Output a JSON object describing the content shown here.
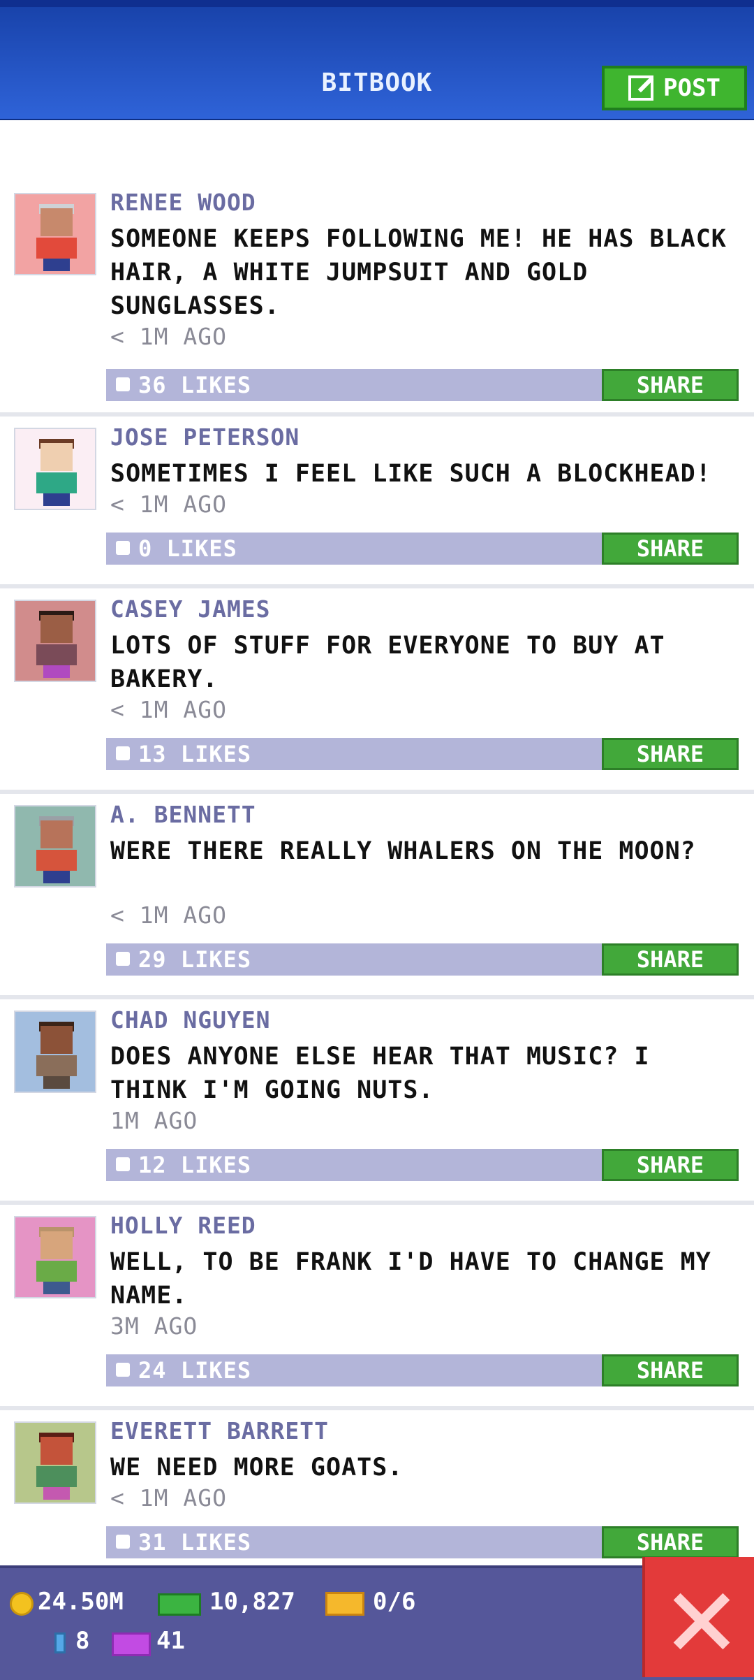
{
  "header": {
    "title": "BITBOOK",
    "post_label": "POST"
  },
  "posts": [
    {
      "name": "RENEE WOOD",
      "message": "SOMEONE KEEPS FOLLOWING ME! HE HAS BLACK HAIR, A WHITE JUMPSUIT AND GOLD SUNGLASSES.",
      "time": "< 1M AGO",
      "likes": "36 LIKES",
      "share": "SHARE",
      "avatar_bg": "#f2a3a3"
    },
    {
      "name": "JOSE PETERSON",
      "message": "SOMETIMES I FEEL LIKE SUCH A BLOCKHEAD!",
      "time": "< 1M AGO",
      "likes": "0 LIKES",
      "share": "SHARE",
      "avatar_bg": "#fbeef4"
    },
    {
      "name": "CASEY JAMES",
      "message": "LOTS OF STUFF FOR EVERYONE TO BUY AT BAKERY.",
      "time": "< 1M AGO",
      "likes": "13 LIKES",
      "share": "SHARE",
      "avatar_bg": "#d18c8c"
    },
    {
      "name": "A. BENNETT",
      "message": "WERE THERE REALLY WHALERS ON THE MOON?",
      "time": "< 1M AGO",
      "likes": "29 LIKES",
      "share": "SHARE",
      "avatar_bg": "#90b8ae"
    },
    {
      "name": "CHAD NGUYEN",
      "message": "DOES ANYONE ELSE HEAR THAT MUSIC? I THINK I'M GOING NUTS.",
      "time": "1M AGO",
      "likes": "12 LIKES",
      "share": "SHARE",
      "avatar_bg": "#a3bedf"
    },
    {
      "name": "HOLLY REED",
      "message": "WELL, TO BE FRANK I'D HAVE TO CHANGE MY NAME.",
      "time": "3M AGO",
      "likes": "24 LIKES",
      "share": "SHARE",
      "avatar_bg": "#e594c5"
    },
    {
      "name": "EVERETT BARRETT",
      "message": "WE NEED MORE GOATS.",
      "time": "< 1M AGO",
      "likes": "31 LIKES",
      "share": "SHARE",
      "avatar_bg": "#b7c78b"
    }
  ],
  "bottom": {
    "coins": "24.50M",
    "bux": "10,827",
    "tickets": "0/6",
    "battery": "8",
    "vip": "41"
  },
  "icons": {
    "coin": "coin-icon",
    "bux": "bux-icon",
    "ticket": "ticket-icon",
    "battery": "battery-icon",
    "vip": "vip-icon",
    "close": "close-icon",
    "post": "edit-icon"
  }
}
